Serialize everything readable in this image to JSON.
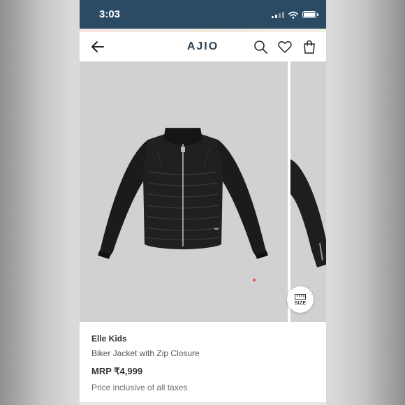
{
  "status_bar": {
    "time": "3:03"
  },
  "header": {
    "brand": "AJIO",
    "icons": [
      "arrow-left-icon",
      "search-icon",
      "heart-icon",
      "shopping-bag-icon"
    ]
  },
  "gallery": {
    "current_image": "black-biker-jacket-front",
    "size_button_label": "SIZE"
  },
  "product": {
    "brand": "Elle Kids",
    "name": "Biker Jacket with Zip Closure",
    "price": "MRP ₹4,999",
    "tax_note": "Price inclusive of all taxes"
  },
  "colors": {
    "status_bar": "#2b4a63",
    "brand_text": "#2c4152",
    "image_background": "#d1d1d1",
    "active_dot": "#e2573c"
  }
}
